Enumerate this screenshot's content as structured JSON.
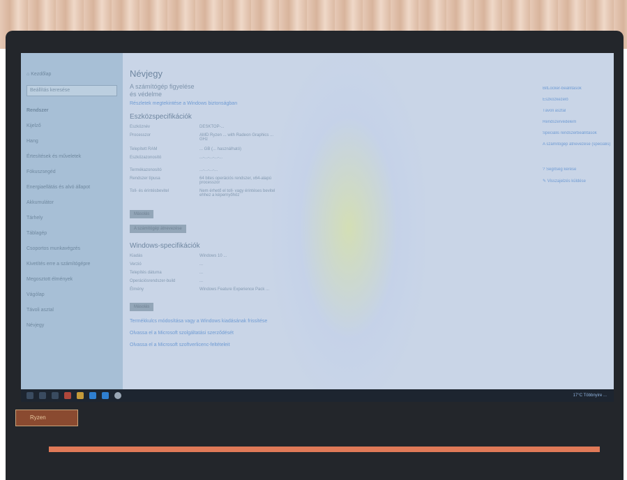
{
  "page": {
    "title": "Névjegy",
    "subtitle_line1": "A számítógép figyelése",
    "subtitle_line2": "és védelme",
    "link_details": "Részletek megtekintése a Windows biztonságban"
  },
  "device_specs": {
    "heading": "Eszközspecifikációk",
    "rows": [
      {
        "key": "Eszköznév",
        "value": "DESKTOP-..."
      },
      {
        "key": "Processzor",
        "value": "AMD Ryzen ... with Radeon Graphics ... GHz"
      },
      {
        "key": "Telepített RAM",
        "value": "... GB (... használható)"
      },
      {
        "key": "Eszközazonosító",
        "value": "...-...-...-...-..."
      },
      {
        "key": "Termékazonosító",
        "value": "...-...-...-..."
      },
      {
        "key": "Rendszer típusa",
        "value": "64 bites operációs rendszer, x64-alapú processzor"
      },
      {
        "key": "Toll- és érintésbevitel",
        "value": "Nem érhető el toll- vagy érintéses bevitel ehhez a képernyőhöz"
      }
    ],
    "copy_button": "Másolás",
    "rename_button": "A számítógép átnevezése"
  },
  "windows_specs": {
    "heading": "Windows-specifikációk",
    "rows": [
      {
        "key": "Kiadás",
        "value": "Windows 10 ..."
      },
      {
        "key": "Verzió",
        "value": "..."
      },
      {
        "key": "Telepítés dátuma",
        "value": "..."
      },
      {
        "key": "Operációsrendszer-build",
        "value": "..."
      },
      {
        "key": "Élmény",
        "value": "Windows Feature Experience Pack ..."
      }
    ],
    "copy_button": "Másolás",
    "links": [
      "Termékkulcs módosítása vagy a Windows kiadásának frissítése",
      "Olvassa el a Microsoft szolgáltatási szerződését",
      "Olvassa el a Microsoft szoftverlicenc-feltételeit"
    ]
  },
  "sidebar": {
    "home": "Kezdőlap",
    "search_placeholder": "Beállítás keresése",
    "section": "Rendszer",
    "items": [
      "Kijelző",
      "Hang",
      "Értesítések és műveletek",
      "Fókuszsegéd",
      "Energiaellátás és alvó állapot",
      "Akkumulátor",
      "Tárhely",
      "Táblagép",
      "Csoportos munkavégzés",
      "Kivetítés erre a számítógépre",
      "Megosztott élmények",
      "Vágólap",
      "Távoli asztal",
      "Névjegy"
    ]
  },
  "related_settings": {
    "links": [
      "BitLocker-beállítások",
      "Eszközkezelő",
      "Távoli asztal",
      "Rendszervédelem",
      "Speciális rendszerbeállítások",
      "A számítógép átnevezése (speciális)"
    ],
    "help_links": [
      "Segítség kérése",
      "Visszajelzés küldése"
    ]
  },
  "taskbar": {
    "tray_text": "17°C Többnyire ...",
    "icons": [
      "start-icon",
      "search-icon",
      "task-view-icon",
      "edge-icon",
      "explorer-icon",
      "store-icon",
      "mail-icon",
      "settings-icon"
    ]
  },
  "sticker": {
    "text": "Ryzen"
  },
  "colors": {
    "screen_bg": "#c9d5e7",
    "sidebar_bg": "#a7bfd6",
    "link": "#6f9bd3",
    "taskbar": "#1d2530",
    "bezel": "#23262b"
  }
}
